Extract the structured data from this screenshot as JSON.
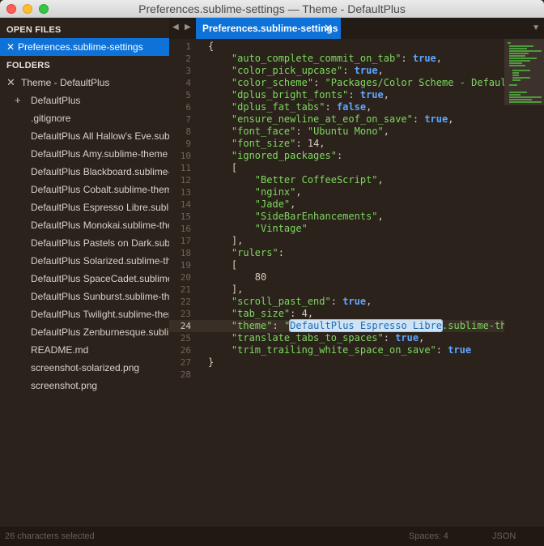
{
  "window": {
    "title": "Preferences.sublime-settings — Theme - DefaultPlus"
  },
  "sidebar": {
    "open_files_heading": "OPEN FILES",
    "open_file": "Preferences.sublime-settings",
    "folders_heading": "FOLDERS",
    "root_folder": "Theme - DefaultPlus",
    "subfolder": "DefaultPlus",
    "files": [
      ".gitignore",
      "DefaultPlus All Hallow's Eve.sublime-theme",
      "DefaultPlus Amy.sublime-theme",
      "DefaultPlus Blackboard.sublime-theme",
      "DefaultPlus Cobalt.sublime-theme",
      "DefaultPlus Espresso Libre.sublime-theme",
      "DefaultPlus Monokai.sublime-theme",
      "DefaultPlus Pastels on Dark.sublime-theme",
      "DefaultPlus Solarized.sublime-theme",
      "DefaultPlus SpaceCadet.sublime-theme",
      "DefaultPlus Sunburst.sublime-theme",
      "DefaultPlus Twilight.sublime-theme",
      "DefaultPlus Zenburnesque.sublime-theme",
      "README.md",
      "screenshot-solarized.png",
      "screenshot.png"
    ]
  },
  "tabs": {
    "active": "Preferences.sublime-settings"
  },
  "editor": {
    "active_line": 24,
    "line_numbers": [
      "1",
      "2",
      "3",
      "4",
      "5",
      "6",
      "7",
      "8",
      "9",
      "10",
      "11",
      "12",
      "13",
      "14",
      "15",
      "16",
      "17",
      "18",
      "19",
      "20",
      "21",
      "22",
      "23",
      "24",
      "25",
      "26",
      "27",
      "28"
    ],
    "code": {
      "l1": "{",
      "l2_key": "\"auto_complete_commit_on_tab\"",
      "l2_val": "true",
      "l3_key": "\"color_pick_upcase\"",
      "l3_val": "true",
      "l4_key": "\"color_scheme\"",
      "l4_val": "\"Packages/Color Scheme - Default/",
      "l5_key": "\"dplus_bright_fonts\"",
      "l5_val": "true",
      "l6_key": "\"dplus_fat_tabs\"",
      "l6_val": "false",
      "l7_key": "\"ensure_newline_at_eof_on_save\"",
      "l7_val": "true",
      "l8_key": "\"font_face\"",
      "l8_val": "\"Ubuntu Mono\"",
      "l9_key": "\"font_size\"",
      "l9_val": "14",
      "l10_key": "\"ignored_packages\"",
      "l11": "[",
      "l12": "\"Better CoffeeScript\"",
      "l13": "\"nginx\"",
      "l14": "\"Jade\"",
      "l15": "\"SideBarEnhancements\"",
      "l16": "\"Vintage\"",
      "l17": "],",
      "l18_key": "\"rulers\"",
      "l19": "[",
      "l20": "80",
      "l21": "],",
      "l22_key": "\"scroll_past_end\"",
      "l22_val": "true",
      "l23_key": "\"tab_size\"",
      "l23_val": "4",
      "l24_key": "\"theme\"",
      "l24_quote": "\"",
      "l24_sel": "DefaultPlus Espresso Libre",
      "l24_rest": ".sublime-them",
      "l25_key": "\"translate_tabs_to_spaces\"",
      "l25_val": "true",
      "l26_key": "\"trim_trailing_white_space_on_save\"",
      "l26_val": "true",
      "l27": "}"
    }
  },
  "status": {
    "selection": "26 characters selected",
    "spaces": "Spaces: 4",
    "syntax": "JSON"
  },
  "colors": {
    "accent": "#0e72d9",
    "background": "#2b221c",
    "string": "#7ed85f",
    "keyword": "#5ea6ff"
  }
}
